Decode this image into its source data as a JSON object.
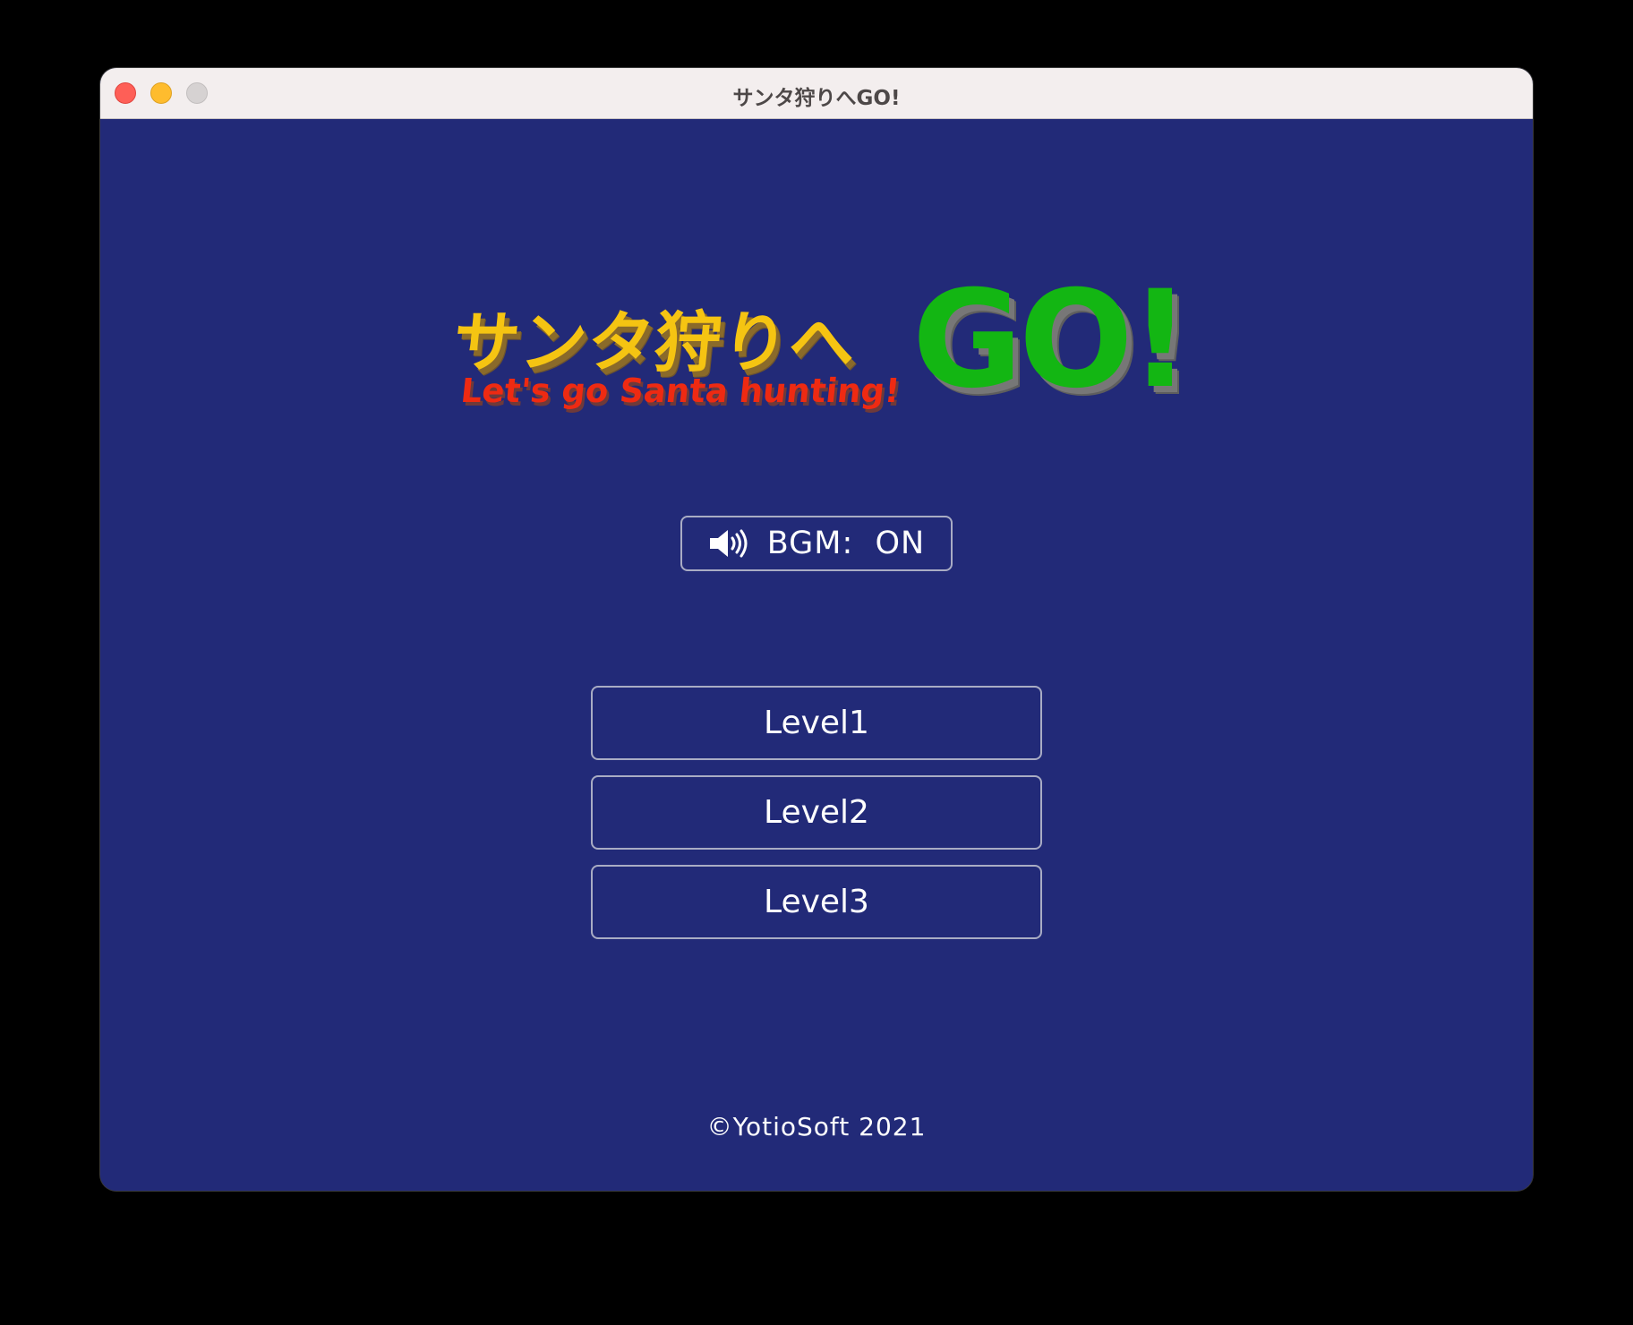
{
  "window": {
    "title": "サンタ狩りへGO!"
  },
  "logo": {
    "title_jp": "サンタ狩りへ",
    "title_go": "GO!",
    "subtitle_en": "Let's go Santa hunting!"
  },
  "bgm": {
    "label": "BGM:  ON",
    "icon": "speaker-icon",
    "state": "ON"
  },
  "levels": [
    {
      "label": "Level1"
    },
    {
      "label": "Level2"
    },
    {
      "label": "Level3"
    }
  ],
  "footer": {
    "copyright": "©YotioSoft 2021"
  },
  "colors": {
    "background": "#222a78",
    "logo_jp": "#f5c412",
    "logo_en": "#ee2a12",
    "logo_go": "#13b613",
    "button_border": "#a9acc4",
    "text": "#ffffff"
  }
}
